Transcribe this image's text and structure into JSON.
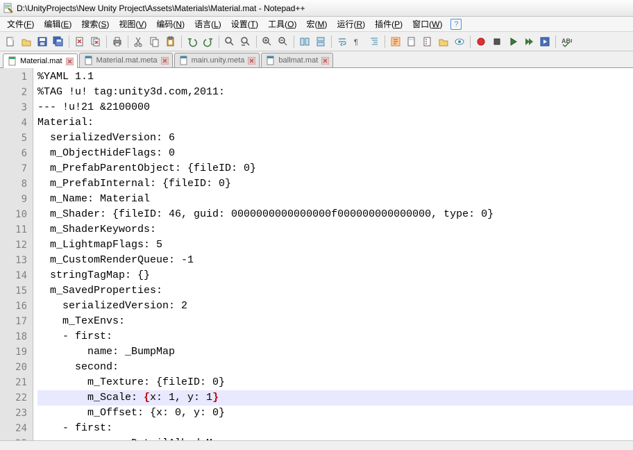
{
  "window": {
    "title": "D:\\UnityProjects\\New Unity Project\\Assets\\Materials\\Material.mat - Notepad++"
  },
  "menus": [
    {
      "label": "文件(F)",
      "u": "F"
    },
    {
      "label": "编辑(E)",
      "u": "E"
    },
    {
      "label": "搜索(S)",
      "u": "S"
    },
    {
      "label": "视图(V)",
      "u": "V"
    },
    {
      "label": "编码(N)",
      "u": "N"
    },
    {
      "label": "语言(L)",
      "u": "L"
    },
    {
      "label": "设置(T)",
      "u": "T"
    },
    {
      "label": "工具(O)",
      "u": "O"
    },
    {
      "label": "宏(M)",
      "u": "M"
    },
    {
      "label": "运行(R)",
      "u": "R"
    },
    {
      "label": "插件(P)",
      "u": "P"
    },
    {
      "label": "窗口(W)",
      "u": "W"
    }
  ],
  "tabs": [
    {
      "label": "Material.mat",
      "active": true
    },
    {
      "label": "Material.mat.meta",
      "active": false
    },
    {
      "label": "main.unity.meta",
      "active": false
    },
    {
      "label": "ballmat.mat",
      "active": false
    }
  ],
  "code": {
    "highlightLine": 22,
    "lines": [
      "%YAML 1.1",
      "%TAG !u! tag:unity3d.com,2011:",
      "--- !u!21 &2100000",
      "Material:",
      "  serializedVersion: 6",
      "  m_ObjectHideFlags: 0",
      "  m_PrefabParentObject: {fileID: 0}",
      "  m_PrefabInternal: {fileID: 0}",
      "  m_Name: Material",
      "  m_Shader: {fileID: 46, guid: 0000000000000000f000000000000000, type: 0}",
      "  m_ShaderKeywords:",
      "  m_LightmapFlags: 5",
      "  m_CustomRenderQueue: -1",
      "  stringTagMap: {}",
      "  m_SavedProperties:",
      "    serializedVersion: 2",
      "    m_TexEnvs:",
      "    - first:",
      "        name: _BumpMap",
      "      second:",
      "        m_Texture: {fileID: 0}",
      "        m_Scale: {x: 1, y: 1}",
      "        m_Offset: {x: 0, y: 0}",
      "    - first:",
      "        name: _DetailAlbedoMap"
    ]
  }
}
